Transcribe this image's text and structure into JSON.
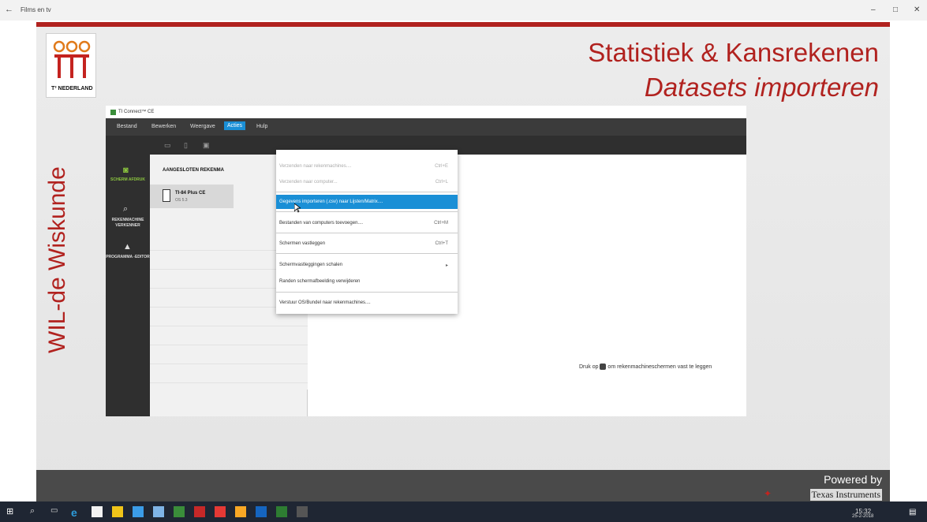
{
  "window": {
    "title": "Films en tv",
    "back": "←",
    "minimize": "–",
    "maximize": "□",
    "close": "✕"
  },
  "slide": {
    "logo_text": "T³ NEDERLAND",
    "heading1": "Statistiek & Kansrekenen",
    "heading2": "Datasets importeren",
    "vertical_text": "WIL-de Wiskunde",
    "powered_by": "Powered by",
    "ti_brand": "Texas Instruments"
  },
  "app": {
    "title": "TI Connect™ CE",
    "menus": [
      "Bestand",
      "Bewerken",
      "Weergave",
      "Acties",
      "Hulp"
    ],
    "sidebar": [
      {
        "label": "SCHERM AFDRUK",
        "icon": "camera-icon"
      },
      {
        "label": "REKENMACHINE VERKENNER",
        "icon": "search-icon"
      },
      {
        "label": "PROGRAMMA -EDITOR",
        "icon": "program-icon"
      }
    ],
    "panel_heading": "AANGESLOTEN REKENMA",
    "calculator": {
      "name": "TI-84 Plus CE",
      "os": "OS 5.3"
    },
    "hint_before": "Druk op",
    "hint_after": "om rekenmachineschermen vast te leggen",
    "dropdown": [
      {
        "label": "Verzenden naar rekenmachines....",
        "shortcut": "Ctrl+E",
        "disabled": true
      },
      {
        "label": "Verzenden naar computer...",
        "shortcut": "Ctrl+L",
        "disabled": true
      },
      {
        "label": "Gegevens importeren (.csv) naar Lijsten/Matrix....",
        "shortcut": "",
        "highlight": true
      },
      {
        "label": "Bestanden van computers toevoegen....",
        "shortcut": "Ctrl+M"
      },
      {
        "label": "Schermen vastleggen",
        "shortcut": "Ctrl+T"
      },
      {
        "label": "Schermvastleggingen schalen",
        "shortcut": "▸"
      },
      {
        "label": "Randen schermafbeelding verwijderen",
        "shortcut": ""
      },
      {
        "label": "Verstuur OS/Bundel naar rekenmachines....",
        "shortcut": ""
      }
    ]
  },
  "taskbar": {
    "time": "15:32",
    "date": "25-2-2018"
  },
  "colors": {
    "accent_red": "#b1221f",
    "menu_blue": "#1a8fd6"
  }
}
